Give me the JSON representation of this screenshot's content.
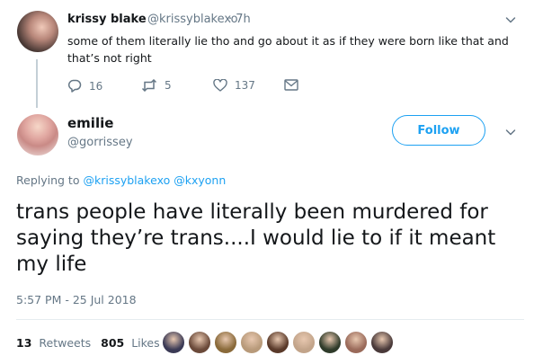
{
  "parent_tweet": {
    "name": "krissy blake",
    "handle": "@krissyblakexo",
    "time": "· 7h",
    "text": "some of them literally lie tho and go about it as if they were born like that and that’s not right",
    "reply_count": "16",
    "retweet_count": "5",
    "like_count": "137"
  },
  "main_tweet": {
    "name": "emilie",
    "handle": "@gorrissey",
    "follow_label": "Follow",
    "replying_prefix": "Replying to",
    "replying_to_1": "@krissyblakexo",
    "replying_to_2": "@kxyonn",
    "text": "trans people have literally been murdered for saying they’re trans....I would lie to if it meant my life",
    "timestamp": "5:57 PM - 25 Jul 2018",
    "retweets_count": "13",
    "retweets_label": "Retweets",
    "likes_count": "805",
    "likes_label": "Likes"
  },
  "colors": {
    "accent": "#1da1f2",
    "muted": "#657786",
    "text": "#14171a",
    "liker_avatars": [
      "#3b3a55",
      "#6b4a3a",
      "#8a6a3a",
      "#b89a7a",
      "#5a3a2a",
      "#c2a48a",
      "#2f3b2a",
      "#9a6a5a",
      "#4a3a3a"
    ]
  }
}
